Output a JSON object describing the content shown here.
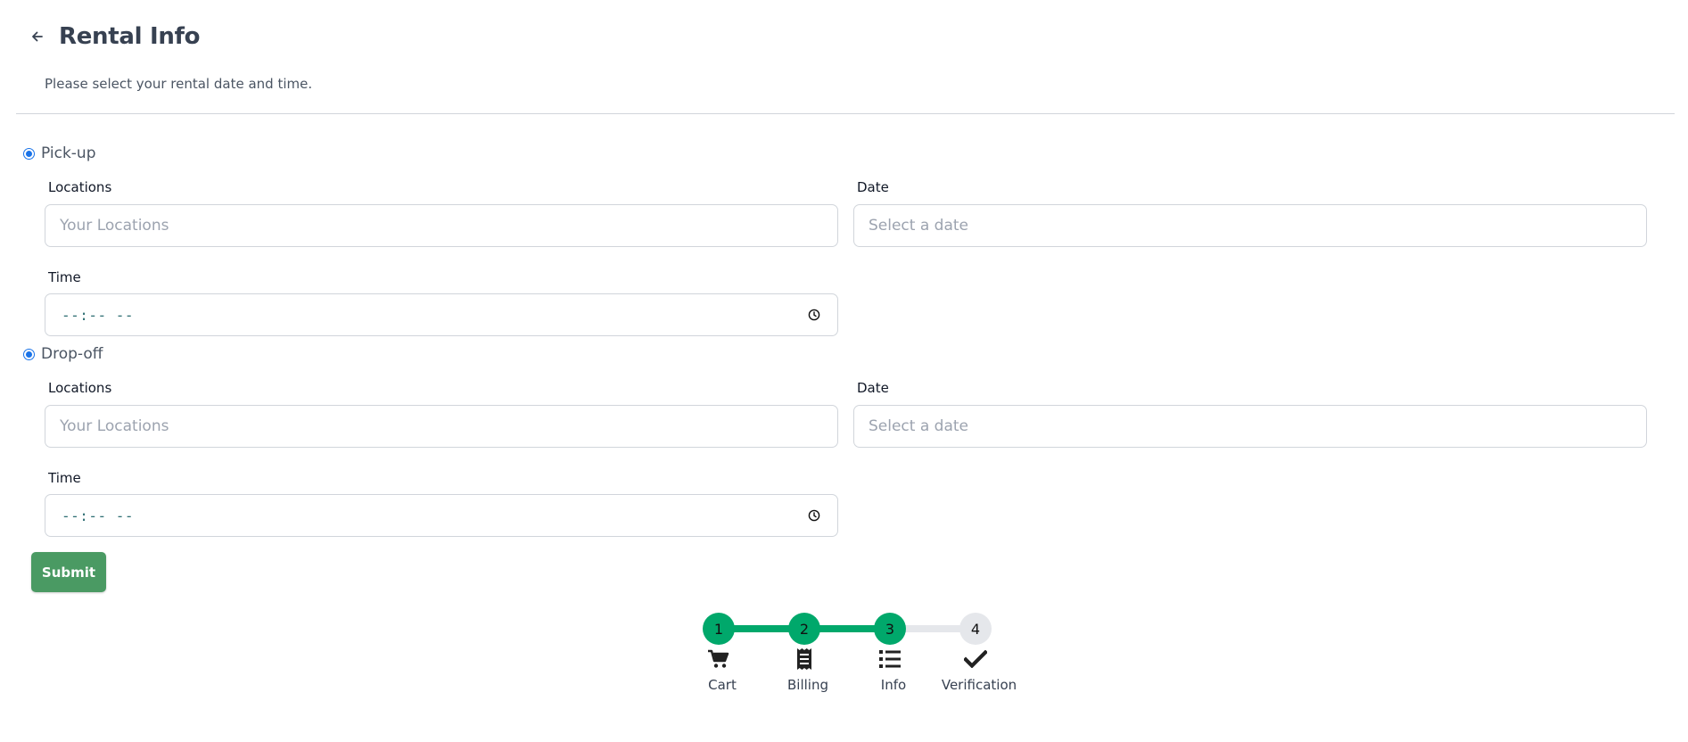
{
  "header": {
    "back_icon": "arrow-left-icon",
    "title": "Rental Info",
    "subtitle": "Please select your rental date and time."
  },
  "pickup": {
    "label": "Pick-up",
    "selected": true,
    "locations_label": "Locations",
    "locations_placeholder": "Your Locations",
    "date_label": "Date",
    "date_placeholder": "Select a date",
    "time_label": "Time",
    "time_value": "--:-- --"
  },
  "dropoff": {
    "label": "Drop-off",
    "selected": true,
    "locations_label": "Locations",
    "locations_placeholder": "Your Locations",
    "date_label": "Date",
    "date_placeholder": "Select a date",
    "time_label": "Time",
    "time_value": "--:-- --"
  },
  "submit_label": "Submit",
  "stepper": {
    "completed_color": "#00a86b",
    "pending_color": "#e5e7eb",
    "steps": [
      {
        "number": "1",
        "label": "Cart",
        "icon": "cart-icon",
        "done": true
      },
      {
        "number": "2",
        "label": "Billing",
        "icon": "receipt-icon",
        "done": true
      },
      {
        "number": "3",
        "label": "Info",
        "icon": "list-icon",
        "done": true
      },
      {
        "number": "4",
        "label": "Verification",
        "icon": "check-icon",
        "done": false
      }
    ]
  }
}
